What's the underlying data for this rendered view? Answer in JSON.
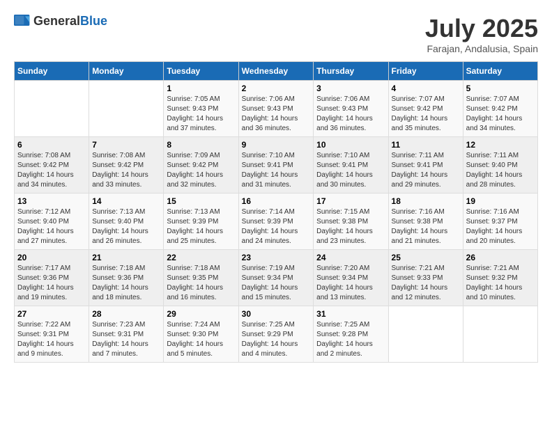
{
  "logo": {
    "general": "General",
    "blue": "Blue"
  },
  "title": "July 2025",
  "subtitle": "Farajan, Andalusia, Spain",
  "weekdays": [
    "Sunday",
    "Monday",
    "Tuesday",
    "Wednesday",
    "Thursday",
    "Friday",
    "Saturday"
  ],
  "weeks": [
    [
      {
        "day": "",
        "sunrise": "",
        "sunset": "",
        "daylight": ""
      },
      {
        "day": "",
        "sunrise": "",
        "sunset": "",
        "daylight": ""
      },
      {
        "day": "1",
        "sunrise": "Sunrise: 7:05 AM",
        "sunset": "Sunset: 9:43 PM",
        "daylight": "Daylight: 14 hours and 37 minutes."
      },
      {
        "day": "2",
        "sunrise": "Sunrise: 7:06 AM",
        "sunset": "Sunset: 9:43 PM",
        "daylight": "Daylight: 14 hours and 36 minutes."
      },
      {
        "day": "3",
        "sunrise": "Sunrise: 7:06 AM",
        "sunset": "Sunset: 9:43 PM",
        "daylight": "Daylight: 14 hours and 36 minutes."
      },
      {
        "day": "4",
        "sunrise": "Sunrise: 7:07 AM",
        "sunset": "Sunset: 9:42 PM",
        "daylight": "Daylight: 14 hours and 35 minutes."
      },
      {
        "day": "5",
        "sunrise": "Sunrise: 7:07 AM",
        "sunset": "Sunset: 9:42 PM",
        "daylight": "Daylight: 14 hours and 34 minutes."
      }
    ],
    [
      {
        "day": "6",
        "sunrise": "Sunrise: 7:08 AM",
        "sunset": "Sunset: 9:42 PM",
        "daylight": "Daylight: 14 hours and 34 minutes."
      },
      {
        "day": "7",
        "sunrise": "Sunrise: 7:08 AM",
        "sunset": "Sunset: 9:42 PM",
        "daylight": "Daylight: 14 hours and 33 minutes."
      },
      {
        "day": "8",
        "sunrise": "Sunrise: 7:09 AM",
        "sunset": "Sunset: 9:42 PM",
        "daylight": "Daylight: 14 hours and 32 minutes."
      },
      {
        "day": "9",
        "sunrise": "Sunrise: 7:10 AM",
        "sunset": "Sunset: 9:41 PM",
        "daylight": "Daylight: 14 hours and 31 minutes."
      },
      {
        "day": "10",
        "sunrise": "Sunrise: 7:10 AM",
        "sunset": "Sunset: 9:41 PM",
        "daylight": "Daylight: 14 hours and 30 minutes."
      },
      {
        "day": "11",
        "sunrise": "Sunrise: 7:11 AM",
        "sunset": "Sunset: 9:41 PM",
        "daylight": "Daylight: 14 hours and 29 minutes."
      },
      {
        "day": "12",
        "sunrise": "Sunrise: 7:11 AM",
        "sunset": "Sunset: 9:40 PM",
        "daylight": "Daylight: 14 hours and 28 minutes."
      }
    ],
    [
      {
        "day": "13",
        "sunrise": "Sunrise: 7:12 AM",
        "sunset": "Sunset: 9:40 PM",
        "daylight": "Daylight: 14 hours and 27 minutes."
      },
      {
        "day": "14",
        "sunrise": "Sunrise: 7:13 AM",
        "sunset": "Sunset: 9:40 PM",
        "daylight": "Daylight: 14 hours and 26 minutes."
      },
      {
        "day": "15",
        "sunrise": "Sunrise: 7:13 AM",
        "sunset": "Sunset: 9:39 PM",
        "daylight": "Daylight: 14 hours and 25 minutes."
      },
      {
        "day": "16",
        "sunrise": "Sunrise: 7:14 AM",
        "sunset": "Sunset: 9:39 PM",
        "daylight": "Daylight: 14 hours and 24 minutes."
      },
      {
        "day": "17",
        "sunrise": "Sunrise: 7:15 AM",
        "sunset": "Sunset: 9:38 PM",
        "daylight": "Daylight: 14 hours and 23 minutes."
      },
      {
        "day": "18",
        "sunrise": "Sunrise: 7:16 AM",
        "sunset": "Sunset: 9:38 PM",
        "daylight": "Daylight: 14 hours and 21 minutes."
      },
      {
        "day": "19",
        "sunrise": "Sunrise: 7:16 AM",
        "sunset": "Sunset: 9:37 PM",
        "daylight": "Daylight: 14 hours and 20 minutes."
      }
    ],
    [
      {
        "day": "20",
        "sunrise": "Sunrise: 7:17 AM",
        "sunset": "Sunset: 9:36 PM",
        "daylight": "Daylight: 14 hours and 19 minutes."
      },
      {
        "day": "21",
        "sunrise": "Sunrise: 7:18 AM",
        "sunset": "Sunset: 9:36 PM",
        "daylight": "Daylight: 14 hours and 18 minutes."
      },
      {
        "day": "22",
        "sunrise": "Sunrise: 7:18 AM",
        "sunset": "Sunset: 9:35 PM",
        "daylight": "Daylight: 14 hours and 16 minutes."
      },
      {
        "day": "23",
        "sunrise": "Sunrise: 7:19 AM",
        "sunset": "Sunset: 9:34 PM",
        "daylight": "Daylight: 14 hours and 15 minutes."
      },
      {
        "day": "24",
        "sunrise": "Sunrise: 7:20 AM",
        "sunset": "Sunset: 9:34 PM",
        "daylight": "Daylight: 14 hours and 13 minutes."
      },
      {
        "day": "25",
        "sunrise": "Sunrise: 7:21 AM",
        "sunset": "Sunset: 9:33 PM",
        "daylight": "Daylight: 14 hours and 12 minutes."
      },
      {
        "day": "26",
        "sunrise": "Sunrise: 7:21 AM",
        "sunset": "Sunset: 9:32 PM",
        "daylight": "Daylight: 14 hours and 10 minutes."
      }
    ],
    [
      {
        "day": "27",
        "sunrise": "Sunrise: 7:22 AM",
        "sunset": "Sunset: 9:31 PM",
        "daylight": "Daylight: 14 hours and 9 minutes."
      },
      {
        "day": "28",
        "sunrise": "Sunrise: 7:23 AM",
        "sunset": "Sunset: 9:31 PM",
        "daylight": "Daylight: 14 hours and 7 minutes."
      },
      {
        "day": "29",
        "sunrise": "Sunrise: 7:24 AM",
        "sunset": "Sunset: 9:30 PM",
        "daylight": "Daylight: 14 hours and 5 minutes."
      },
      {
        "day": "30",
        "sunrise": "Sunrise: 7:25 AM",
        "sunset": "Sunset: 9:29 PM",
        "daylight": "Daylight: 14 hours and 4 minutes."
      },
      {
        "day": "31",
        "sunrise": "Sunrise: 7:25 AM",
        "sunset": "Sunset: 9:28 PM",
        "daylight": "Daylight: 14 hours and 2 minutes."
      },
      {
        "day": "",
        "sunrise": "",
        "sunset": "",
        "daylight": ""
      },
      {
        "day": "",
        "sunrise": "",
        "sunset": "",
        "daylight": ""
      }
    ]
  ]
}
